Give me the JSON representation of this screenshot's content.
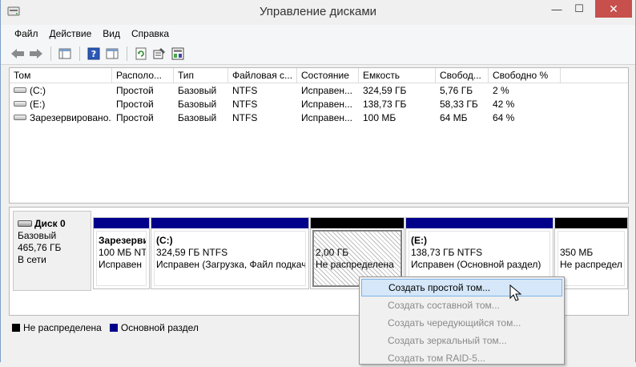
{
  "window": {
    "title": "Управление дисками",
    "min_glyph": "—",
    "max_glyph": "☐",
    "close_glyph": "✕"
  },
  "menu": [
    "Файл",
    "Действие",
    "Вид",
    "Справка"
  ],
  "toolbar": {
    "icons": [
      "back-arrow-icon",
      "forward-arrow-icon",
      "console-tree-icon",
      "help-icon",
      "properties-view-icon",
      "refresh-icon",
      "properties-icon",
      "disk-settings-icon"
    ]
  },
  "volumes": {
    "columns": [
      "Том",
      "Располо...",
      "Тип",
      "Файловая с...",
      "Состояние",
      "Емкость",
      "Свобод...",
      "Свободно %"
    ],
    "rows": [
      [
        "(C:)",
        "Простой",
        "Базовый",
        "NTFS",
        "Исправен...",
        "324,59 ГБ",
        "5,76 ГБ",
        "2 %"
      ],
      [
        "(E:)",
        "Простой",
        "Базовый",
        "NTFS",
        "Исправен...",
        "138,73 ГБ",
        "58,33 ГБ",
        "42 %"
      ],
      [
        "Зарезервировано...",
        "Простой",
        "Базовый",
        "NTFS",
        "Исправен...",
        "100 МБ",
        "64 МБ",
        "64 %"
      ]
    ]
  },
  "disk": {
    "name": "Диск 0",
    "type": "Базовый",
    "size": "465,76 ГБ",
    "status": "В сети"
  },
  "partitions": [
    {
      "name": "Зарезерви",
      "size": "100 МБ NTF",
      "status": "Исправен",
      "kind": "primary"
    },
    {
      "name": "(C:)",
      "size": "324,59 ГБ NTFS",
      "status": "Исправен (Загрузка, Файл подкач",
      "kind": "primary"
    },
    {
      "name": "",
      "size": "2,00 ГБ",
      "status": "Не распределена",
      "kind": "unallocated"
    },
    {
      "name": "(E:)",
      "size": "138,73 ГБ NTFS",
      "status": "Исправен (Основной раздел)",
      "kind": "primary"
    },
    {
      "name": "",
      "size": "350 МБ",
      "status": "Не распредел",
      "kind": "unallocated"
    }
  ],
  "legend": {
    "unallocated": "Не распределена",
    "primary": "Основной раздел",
    "unallocated_color": "#000000",
    "primary_color": "#00008b"
  },
  "context_menu": {
    "items": [
      {
        "label": "Создать простой том...",
        "enabled": true
      },
      {
        "label": "Создать составной том...",
        "enabled": false
      },
      {
        "label": "Создать чередующийся том...",
        "enabled": false
      },
      {
        "label": "Создать зеркальный том...",
        "enabled": false
      },
      {
        "label": "Создать том RAID-5...",
        "enabled": false
      }
    ]
  }
}
